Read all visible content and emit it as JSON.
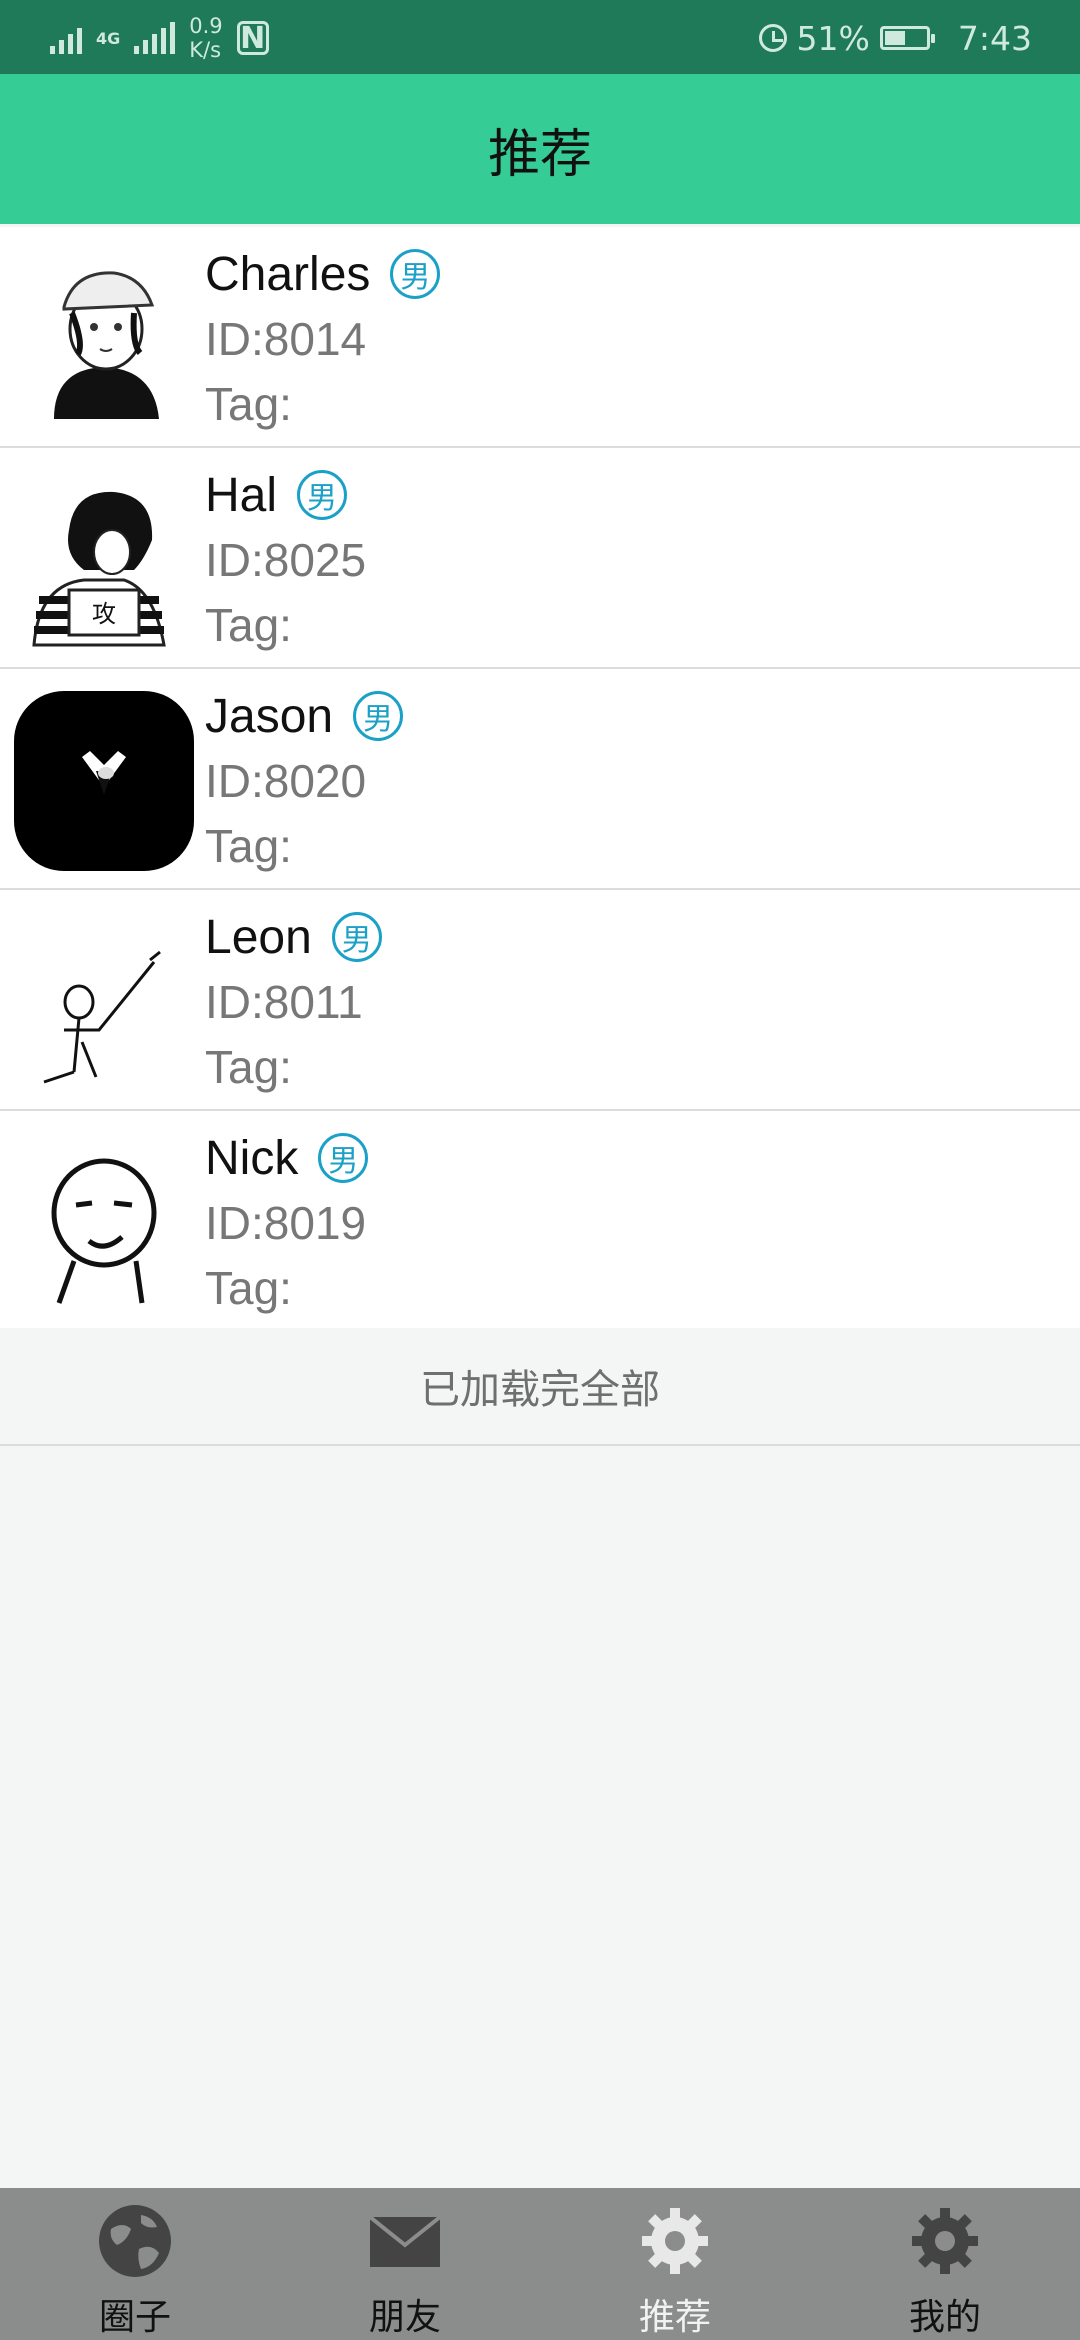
{
  "status_bar": {
    "network_type": "4G",
    "speed_value": "0.9",
    "speed_unit": "K/s",
    "nfc_label": "N",
    "battery_percent": "51%",
    "battery_level": 0.51,
    "time": "7:43"
  },
  "header": {
    "title": "推荐"
  },
  "users": [
    {
      "name": "Charles",
      "gender": "男",
      "id": "ID:8014",
      "tag": "Tag:"
    },
    {
      "name": "Hal",
      "gender": "男",
      "id": "ID:8025",
      "tag": "Tag:"
    },
    {
      "name": "Jason",
      "gender": "男",
      "id": "ID:8020",
      "tag": "Tag:"
    },
    {
      "name": "Leon",
      "gender": "男",
      "id": "ID:8011",
      "tag": "Tag:"
    },
    {
      "name": "Nick",
      "gender": "男",
      "id": "ID:8019",
      "tag": "Tag:"
    }
  ],
  "list_footer": "已加载完全部",
  "bottom_nav": [
    {
      "label": "圈子",
      "icon": "globe-icon",
      "active": false
    },
    {
      "label": "朋友",
      "icon": "envelope-icon",
      "active": false
    },
    {
      "label": "推荐",
      "icon": "gear-icon",
      "active": true
    },
    {
      "label": "我的",
      "icon": "gear-icon",
      "active": false
    }
  ],
  "colors": {
    "status_bar": "#1f7a5a",
    "header": "#35cc96",
    "gender_badge": "#1ba0c8",
    "bottom_nav": "#8b8d8d"
  }
}
